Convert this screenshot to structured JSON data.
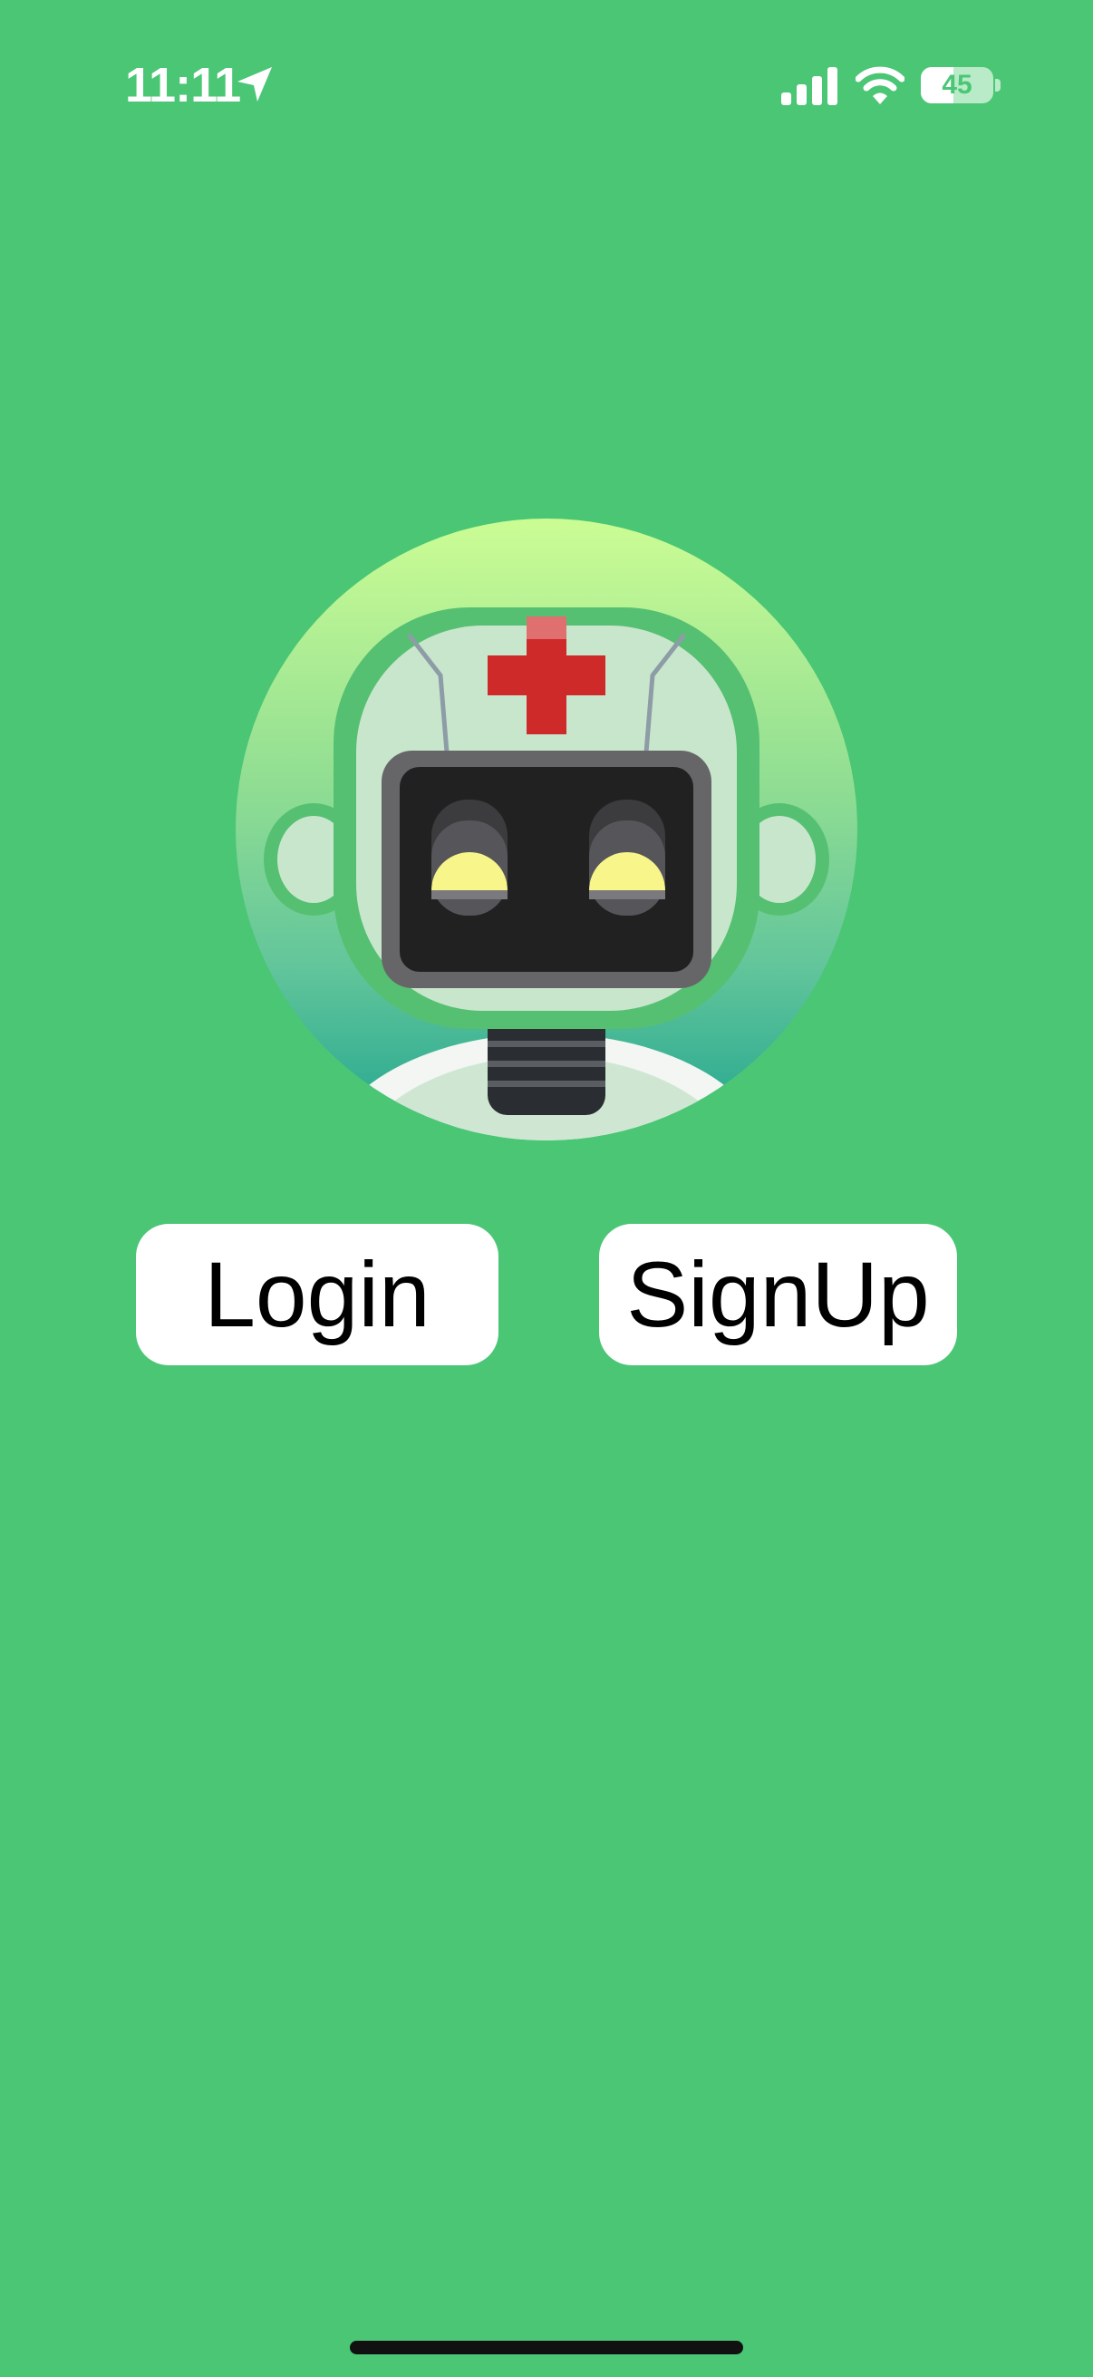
{
  "status_bar": {
    "time": "11:11",
    "battery_level": 45,
    "battery_text": "45",
    "location_icon": "location-arrow-icon",
    "signal_icon": "cellular-signal-icon",
    "wifi_icon": "wifi-icon"
  },
  "avatar": {
    "icon": "medical-robot-avatar"
  },
  "buttons": {
    "login_label": "Login",
    "signup_label": "SignUp"
  },
  "colors": {
    "background": "#4ac675",
    "button_background": "#ffffff",
    "button_text": "#000000",
    "cross_red": "#cf2a2a",
    "eye_yellow": "#f8f58a"
  }
}
